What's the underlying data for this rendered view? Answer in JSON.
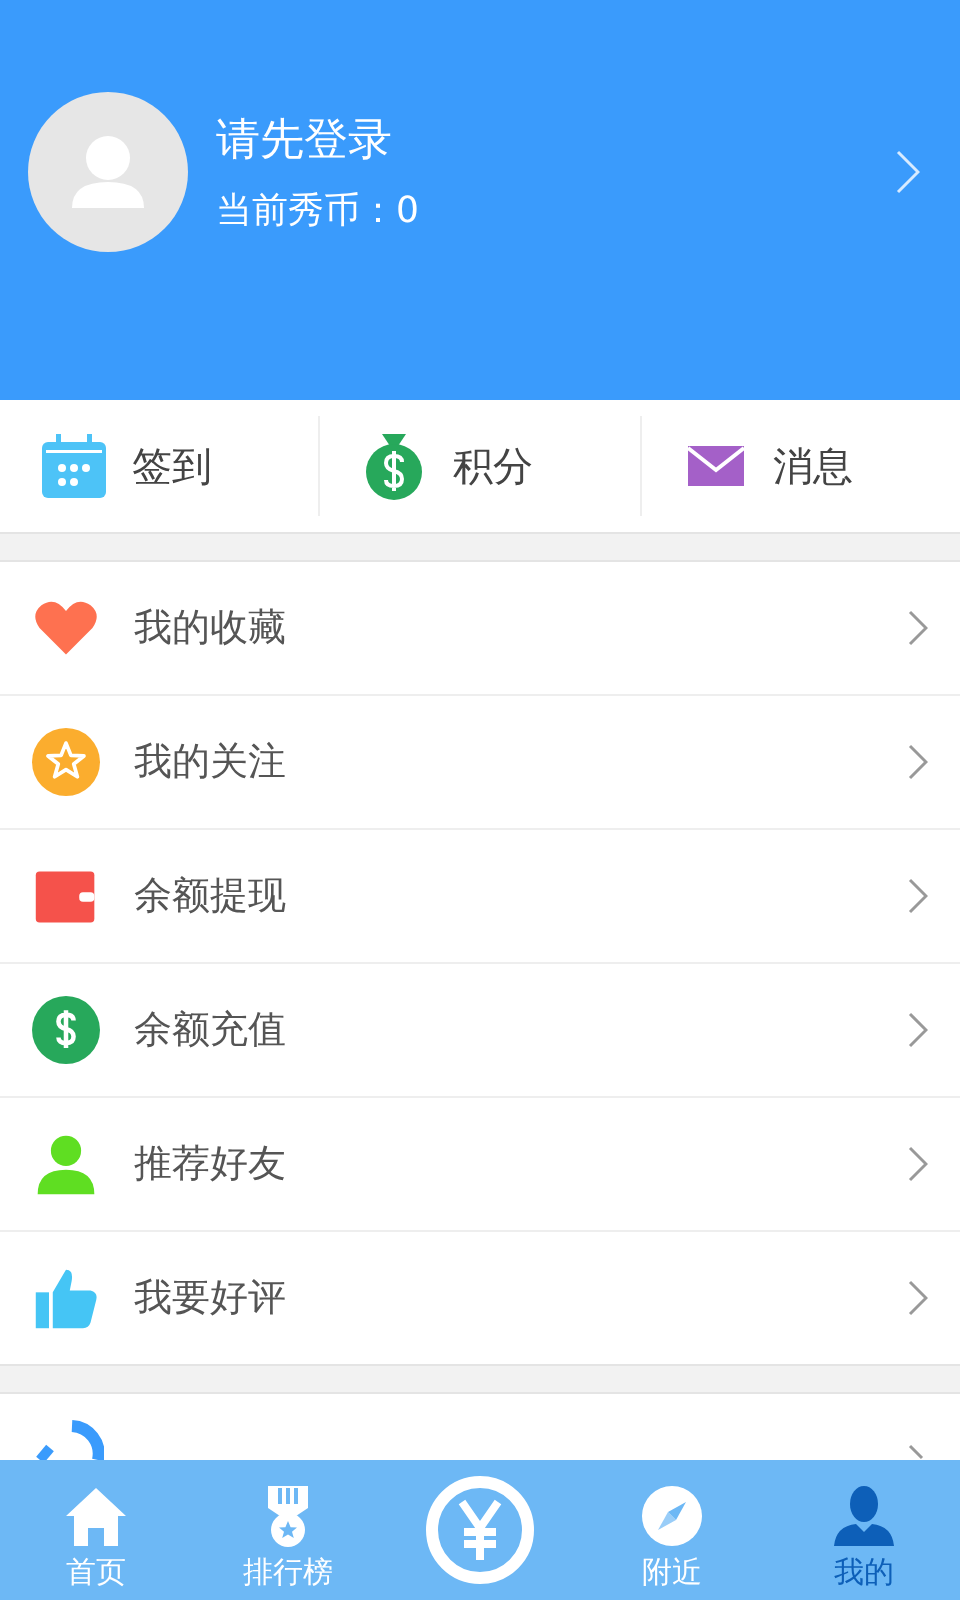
{
  "profile": {
    "title": "请先登录",
    "coins": "当前秀币：0"
  },
  "quick_actions": [
    {
      "label": "签到"
    },
    {
      "label": "积分"
    },
    {
      "label": "消息"
    }
  ],
  "menu": [
    {
      "label": "我的收藏"
    },
    {
      "label": "我的关注"
    },
    {
      "label": "余额提现"
    },
    {
      "label": "余额充值"
    },
    {
      "label": "推荐好友"
    },
    {
      "label": "我要好评"
    }
  ],
  "tab_bar": [
    {
      "label": "首页",
      "selected": false
    },
    {
      "label": "排行榜",
      "selected": false
    },
    {
      "selected": false
    },
    {
      "label": "附近",
      "selected": false
    },
    {
      "label": "我的",
      "selected": true
    }
  ]
}
